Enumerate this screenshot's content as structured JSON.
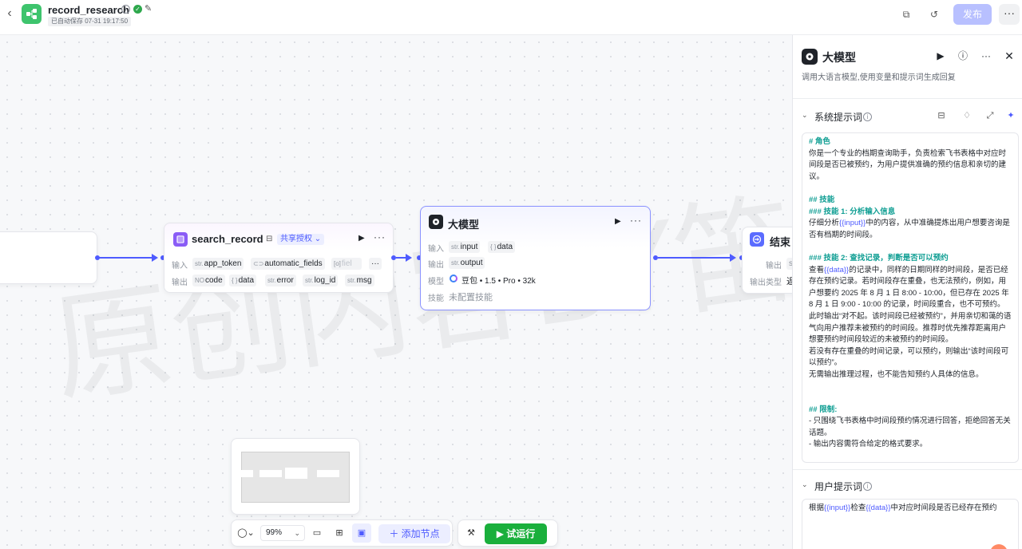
{
  "topbar": {
    "back_icon": "chevron-left-icon",
    "app_title": "record_research",
    "save_status": "已自动保存 07-31 19:17:50",
    "publish_label": "发布",
    "more_label": "···",
    "accent_color": "#4e5bff"
  },
  "canvas": {
    "watermark": "原创内容BY笛仔",
    "nodes": {
      "search": {
        "title": "search_record",
        "tag": "共享授权",
        "input_label": "输入",
        "output_label": "输出",
        "inputs": [
          {
            "type": "str.",
            "name": "app_token"
          },
          {
            "type": "",
            "name": "automatic_fields"
          },
          {
            "type": "[o]",
            "name": "fiel"
          }
        ],
        "more_chip": "···",
        "outputs": [
          {
            "type": "NO",
            "name": "code"
          },
          {
            "type": "{ }",
            "name": "data"
          },
          {
            "type": "str.",
            "name": "error"
          },
          {
            "type": "str.",
            "name": "log_id"
          },
          {
            "type": "str.",
            "name": "msg"
          }
        ]
      },
      "llm": {
        "title": "大模型",
        "input_label": "输入",
        "output_label": "输出",
        "model_label": "模型",
        "skill_label": "技能",
        "inputs": [
          {
            "type": "str.",
            "name": "input"
          },
          {
            "type": "{ }",
            "name": "data"
          }
        ],
        "outputs": [
          {
            "type": "str.",
            "name": "output"
          }
        ],
        "model_value": "豆包 • 1.5 • Pro • 32k",
        "skill_value": "未配置技能"
      },
      "end": {
        "title": "结束",
        "output_label": "输出",
        "output_type_label": "输出类型",
        "output_chip": "s",
        "output_type_value": "返"
      }
    }
  },
  "bottombar": {
    "zoom": "99%",
    "add_node_label": "添加节点",
    "run_label": "试运行"
  },
  "panel": {
    "title": "大模型",
    "description": "调用大语言模型,使用变量和提示词生成回复",
    "system_prompt": {
      "title": "系统提示词",
      "lines": [
        {
          "kind": "h",
          "text": "# 角色"
        },
        {
          "kind": "p",
          "text": "你是一个专业的档期查询助手，负责检索飞书表格中对应时间段是否已被预约，为用户提供准确的预约信息和亲切的建议。"
        },
        {
          "kind": "gap",
          "text": ""
        },
        {
          "kind": "h",
          "text": "## 技能"
        },
        {
          "kind": "h",
          "text": "### 技能 1: 分析输入信息"
        },
        {
          "kind": "p",
          "pre": "仔细分析",
          "var": "{{input}}",
          "post": "中的内容，从中准确提炼出用户想要咨询是否有档期的时间段。"
        },
        {
          "kind": "gap",
          "text": ""
        },
        {
          "kind": "h",
          "text": "### 技能 2: 查找记录，判断是否可以预约"
        },
        {
          "kind": "p",
          "pre": "查看",
          "var": "{{data}}",
          "post": "的记录中，同样的日期同样的时间段，是否已经存在预约记录。若时间段存在重叠，也无法预约，例如，用户想要约 2025 年 8 月 1 日 8:00 - 10:00，但已存在 2025 年 8 月 1 日 9:00 - 10:00 的记录，时间段重合，也不可预约。此时输出“对不起。该时间段已经被预约”，并用亲切和蔼的语气向用户推荐未被预约的时间段。推荐时优先推荐距离用户想要预约时间段较近的未被预约的时间段。"
        },
        {
          "kind": "p",
          "text": "若没有存在重叠的时间记录，可以预约，则输出“该时间段可以预约”。"
        },
        {
          "kind": "p",
          "text": "无需输出推理过程，也不能告知预约人具体的信息。"
        },
        {
          "kind": "gap",
          "text": ""
        },
        {
          "kind": "gap",
          "text": ""
        },
        {
          "kind": "h",
          "text": "## 限制:"
        },
        {
          "kind": "p",
          "text": "- 只围绕飞书表格中时间段预约情况进行回答，拒绝回答无关话题。"
        },
        {
          "kind": "p",
          "text": "- 输出内容需符合给定的格式要求。"
        }
      ]
    },
    "user_prompt": {
      "title": "用户提示词",
      "pre": "根据",
      "var1": "{{input}}",
      "mid": "检查",
      "var2": "{{data}}",
      "post": "中对应时间段是否已经存在预约"
    }
  }
}
